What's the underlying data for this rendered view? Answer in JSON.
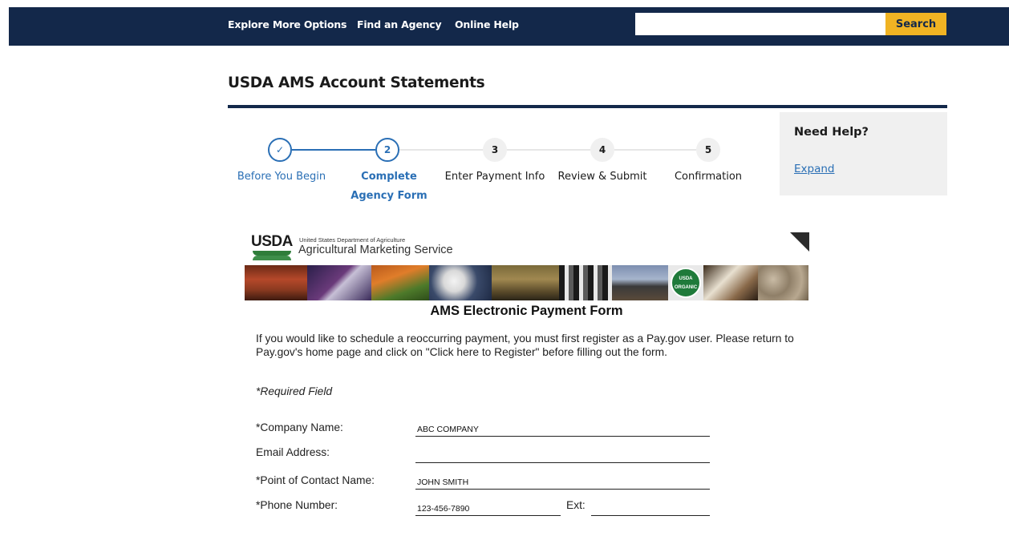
{
  "topnav": {
    "links": [
      "Explore More Options",
      "Find an Agency",
      "Online Help"
    ],
    "search": {
      "value": "",
      "placeholder": "",
      "button_label": "Search"
    },
    "colors": {
      "background": "#13284a",
      "button": "#f0b323"
    }
  },
  "page": {
    "title": "USDA AMS Account Statements",
    "accent_color": "#2a6fb5"
  },
  "stepper": {
    "steps": [
      {
        "marker": "✓",
        "label": "Before You Begin",
        "state": "done"
      },
      {
        "marker": "2",
        "label": "Complete Agency Form",
        "state": "current"
      },
      {
        "marker": "3",
        "label": "Enter Payment Info",
        "state": "upcoming"
      },
      {
        "marker": "4",
        "label": "Review & Submit",
        "state": "upcoming"
      },
      {
        "marker": "5",
        "label": "Confirmation",
        "state": "upcoming"
      }
    ]
  },
  "help": {
    "title": "Need Help?",
    "link": "Expand"
  },
  "ams_form": {
    "logo_text": "USDA",
    "department": "United States Department of Agriculture",
    "agency": "Agricultural Marketing Service",
    "photo_strip": [
      "produce",
      "bird",
      "vegetables",
      "cotton",
      "grain",
      "cattle",
      "train",
      "usda-organic-seal",
      "chef",
      "seeds"
    ],
    "organic_seal": "USDA ORGANIC",
    "title": "AMS Electronic Payment Form",
    "intro": "If you would like to schedule a reoccurring payment, you must first register as a Pay.gov user.  Please return to Pay.gov's home page and click on \"Click here to Register\" before filling out the form.",
    "required_note": "*Required Field",
    "fields": {
      "company_name": {
        "label": "*Company Name:",
        "value": "ABC COMPANY"
      },
      "email": {
        "label": "Email Address:",
        "value": ""
      },
      "contact_name": {
        "label": "*Point of Contact Name:",
        "value": "JOHN SMITH"
      },
      "phone": {
        "label": "*Phone Number:",
        "value": "123-456-7890"
      },
      "ext": {
        "label": "Ext:",
        "value": ""
      }
    }
  }
}
